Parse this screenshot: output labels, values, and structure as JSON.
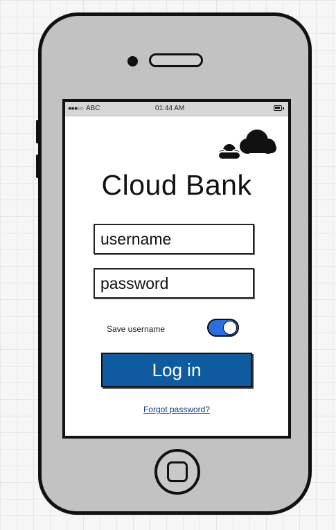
{
  "status_bar": {
    "signal": "●●●○○",
    "carrier": "ABC",
    "time": "01:44 AM"
  },
  "app": {
    "title": "Cloud Bank",
    "logo_icon": "cloud-icon"
  },
  "login_form": {
    "username_placeholder": "username",
    "password_placeholder": "password",
    "save_username_label": "Save username",
    "save_username_on": true,
    "login_label": "Log in",
    "forgot_password_label": "Forgot password?"
  },
  "colors": {
    "accent": "#0e5ba0",
    "toggle_on": "#2a6fe0",
    "link": "#0e3c8a"
  }
}
